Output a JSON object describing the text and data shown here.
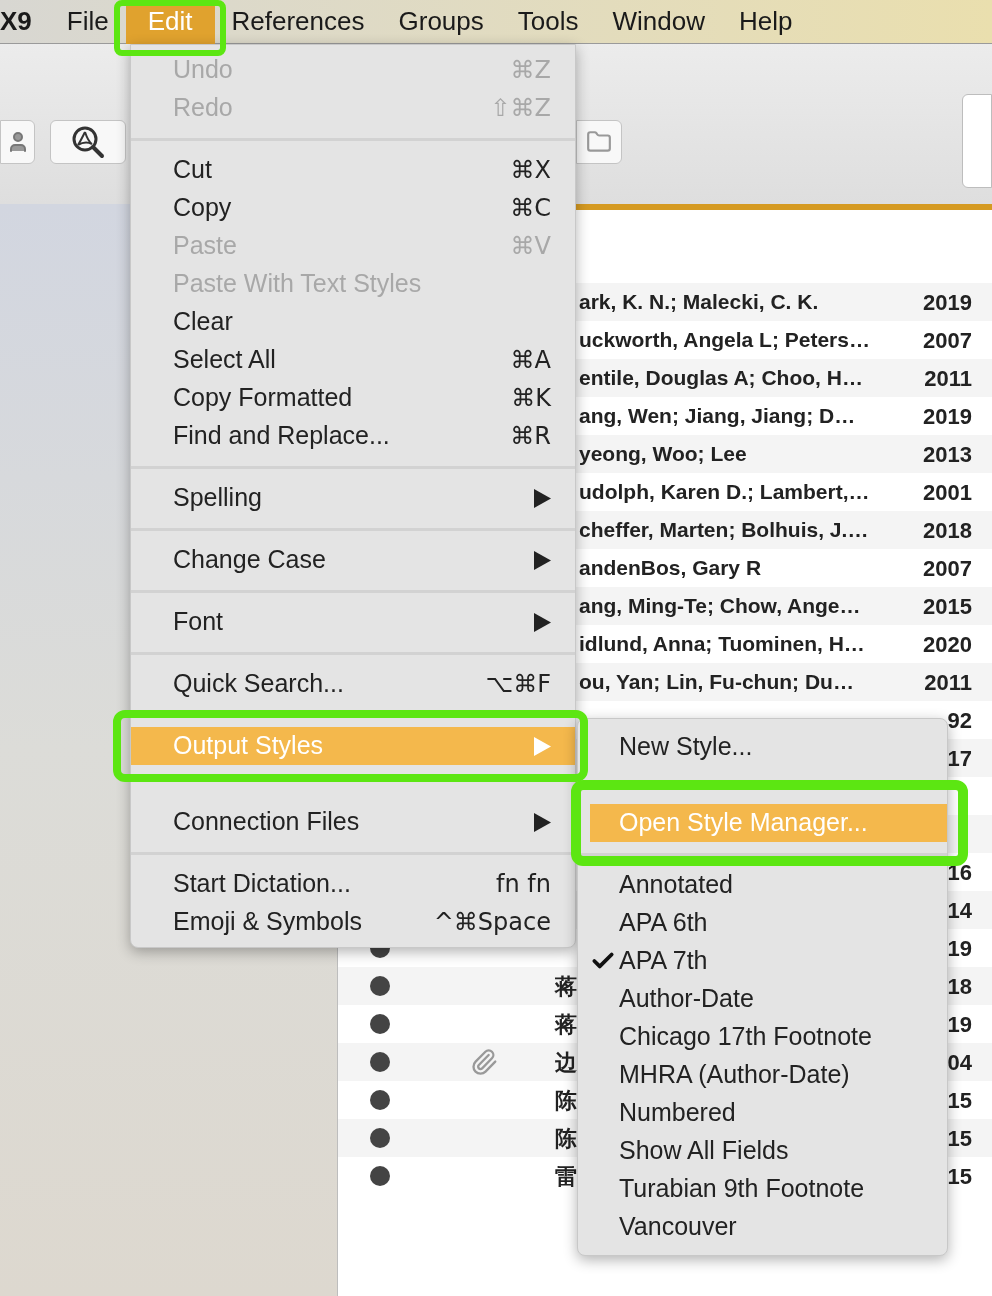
{
  "menubar": {
    "items": [
      {
        "label": "X9",
        "selected": false
      },
      {
        "label": "File",
        "selected": false
      },
      {
        "label": "Edit",
        "selected": true
      },
      {
        "label": "References",
        "selected": false
      },
      {
        "label": "Groups",
        "selected": false
      },
      {
        "label": "Tools",
        "selected": false
      },
      {
        "label": "Window",
        "selected": false
      },
      {
        "label": "Help",
        "selected": false
      }
    ]
  },
  "table": {
    "rows": [
      {
        "author": "ark, K. N.; Malecki, C. K.",
        "year": "2019",
        "dot": false,
        "attachment": false
      },
      {
        "author": "uckworth, Angela L; Peters…",
        "year": "2007",
        "dot": false,
        "attachment": false
      },
      {
        "author": "entile, Douglas A; Choo, H…",
        "year": "2011",
        "dot": false,
        "attachment": false
      },
      {
        "author": "ang, Wen; Jiang, Jiang; D…",
        "year": "2019",
        "dot": false,
        "attachment": false
      },
      {
        "author": "yeong, Woo; Lee",
        "year": "2013",
        "dot": false,
        "attachment": false
      },
      {
        "author": "udolph, Karen D.; Lambert,…",
        "year": "2001",
        "dot": false,
        "attachment": false
      },
      {
        "author": "cheffer, Marten; Bolhuis, J.…",
        "year": "2018",
        "dot": false,
        "attachment": false
      },
      {
        "author": "andenBos, Gary R",
        "year": "2007",
        "dot": false,
        "attachment": false
      },
      {
        "author": "ang, Ming-Te; Chow, Ange…",
        "year": "2015",
        "dot": false,
        "attachment": false
      },
      {
        "author": "idlund, Anna; Tuominen, H…",
        "year": "2020",
        "dot": false,
        "attachment": false
      },
      {
        "author": "ou, Yan; Lin, Fu-chun; Du…",
        "year": "2011",
        "dot": false,
        "attachment": false
      },
      {
        "year": "92",
        "dot": false,
        "attachment": false
      },
      {
        "year": "17",
        "dot": false,
        "attachment": false
      },
      {},
      {
        "dot": false,
        "attachment": false
      },
      {
        "year": "16",
        "dot": false,
        "attachment": false
      },
      {
        "year": "14",
        "dot": false,
        "attachment": false
      },
      {
        "year": "19",
        "dot": true,
        "attachment": false
      },
      {
        "initial": "蒋",
        "year": "18",
        "dot": true,
        "attachment": false
      },
      {
        "initial": "蒋",
        "year": "19",
        "dot": true,
        "attachment": false
      },
      {
        "initial": "边",
        "year": "04",
        "dot": true,
        "attachment": true
      },
      {
        "initial": "陈",
        "year": "15",
        "dot": true,
        "attachment": false
      },
      {
        "initial": "陈",
        "year": "15",
        "dot": true,
        "attachment": false
      },
      {
        "initial": "雷",
        "year": "15",
        "dot": true,
        "attachment": false
      }
    ]
  },
  "edit_menu": {
    "items": [
      {
        "kind": "item",
        "label": "Undo",
        "shortcut": "⌘Z",
        "disabled": true,
        "selected": false
      },
      {
        "kind": "item",
        "label": "Redo",
        "shortcut": "⇧⌘Z",
        "disabled": true,
        "selected": false
      },
      {
        "kind": "separator"
      },
      {
        "kind": "item",
        "label": "Cut",
        "shortcut": "⌘X",
        "disabled": false,
        "selected": false
      },
      {
        "kind": "item",
        "label": "Copy",
        "shortcut": "⌘C",
        "disabled": false,
        "selected": false
      },
      {
        "kind": "item",
        "label": "Paste",
        "shortcut": "⌘V",
        "disabled": true,
        "selected": false
      },
      {
        "kind": "item",
        "label": "Paste With Text Styles",
        "disabled": true,
        "selected": false
      },
      {
        "kind": "item",
        "label": "Clear",
        "disabled": false,
        "selected": false
      },
      {
        "kind": "item",
        "label": "Select All",
        "shortcut": "⌘A",
        "disabled": false,
        "selected": false
      },
      {
        "kind": "item",
        "label": "Copy Formatted",
        "shortcut": "⌘K",
        "disabled": false,
        "selected": false
      },
      {
        "kind": "item",
        "label": "Find and Replace...",
        "shortcut": "⌘R",
        "disabled": false,
        "selected": false
      },
      {
        "kind": "separator"
      },
      {
        "kind": "submenu",
        "label": "Spelling",
        "disabled": false,
        "selected": false
      },
      {
        "kind": "separator"
      },
      {
        "kind": "submenu",
        "label": "Change Case",
        "disabled": false,
        "selected": false
      },
      {
        "kind": "separator"
      },
      {
        "kind": "submenu",
        "label": "Font",
        "disabled": false,
        "selected": false
      },
      {
        "kind": "separator"
      },
      {
        "kind": "item",
        "label": "Quick Search...",
        "shortcut": "⌥⌘F",
        "disabled": false,
        "selected": false
      },
      {
        "kind": "separator"
      },
      {
        "kind": "submenu",
        "label": "Output Styles",
        "disabled": false,
        "selected": true
      },
      {
        "kind": "item"
      },
      {
        "kind": "submenu",
        "label": "Connection Files",
        "disabled": false,
        "selected": false
      },
      {
        "kind": "separator"
      },
      {
        "kind": "item",
        "label": "Start Dictation...",
        "shortcut": "fn fn",
        "disabled": false,
        "selected": false
      },
      {
        "kind": "item",
        "label": "Emoji & Symbols",
        "shortcut": "^⌘Space",
        "disabled": false,
        "selected": false
      }
    ]
  },
  "output_styles_menu": {
    "items": [
      {
        "kind": "item",
        "label": "New Style...",
        "checked": false,
        "selected": false
      },
      {
        "kind": "item"
      },
      {
        "kind": "item",
        "label": "Open Style Manager...",
        "checked": false,
        "selected": true
      },
      {
        "kind": "separator"
      },
      {
        "kind": "item",
        "label": "Annotated",
        "checked": false,
        "selected": false
      },
      {
        "kind": "item",
        "label": "APA 6th",
        "checked": false,
        "selected": false
      },
      {
        "kind": "item",
        "label": "APA 7th",
        "checked": true,
        "selected": false
      },
      {
        "kind": "item",
        "label": "Author-Date",
        "checked": false,
        "selected": false
      },
      {
        "kind": "item",
        "label": "Chicago 17th Footnote",
        "checked": false,
        "selected": false
      },
      {
        "kind": "item",
        "label": "MHRA (Author-Date)",
        "checked": false,
        "selected": false
      },
      {
        "kind": "item",
        "label": "Numbered",
        "checked": false,
        "selected": false
      },
      {
        "kind": "item",
        "label": "Show All Fields",
        "checked": false,
        "selected": false
      },
      {
        "kind": "item",
        "label": "Turabian 9th Footnote",
        "checked": false,
        "selected": false
      },
      {
        "kind": "item",
        "label": "Vancouver",
        "checked": false,
        "selected": false
      }
    ]
  }
}
